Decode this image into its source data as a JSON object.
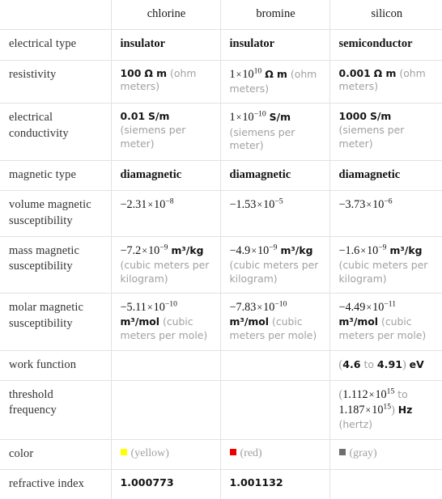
{
  "table": {
    "columns": [
      "",
      "chlorine",
      "bromine",
      "silicon"
    ],
    "rows": [
      {
        "label": "electrical type",
        "cells": [
          {
            "kind": "word",
            "text": "insulator"
          },
          {
            "kind": "word",
            "text": "insulator"
          },
          {
            "kind": "word",
            "text": "semiconductor"
          }
        ]
      },
      {
        "label": "resistivity",
        "cells": [
          {
            "kind": "num_unit",
            "number": "100",
            "unit": "Ω m",
            "note": "(ohm meters)"
          },
          {
            "kind": "sci_unit",
            "mantissa": "1",
            "exponent": "10",
            "unit": "Ω m",
            "note": "(ohm meters)"
          },
          {
            "kind": "num_unit",
            "number": "0.001",
            "unit": "Ω m",
            "note": "(ohm meters)"
          }
        ]
      },
      {
        "label": "electrical conductivity",
        "cells": [
          {
            "kind": "num_unit",
            "number": "0.01",
            "unit": "S/m",
            "note": "(siemens per meter)"
          },
          {
            "kind": "sci_unit",
            "mantissa": "1",
            "exponent": "−10",
            "unit": "S/m",
            "note": "(siemens per meter)"
          },
          {
            "kind": "num_unit",
            "number": "1000",
            "unit": "S/m",
            "note": "(siemens per meter)"
          }
        ]
      },
      {
        "label": "magnetic type",
        "cells": [
          {
            "kind": "word",
            "text": "diamagnetic"
          },
          {
            "kind": "word",
            "text": "diamagnetic"
          },
          {
            "kind": "word",
            "text": "diamagnetic"
          }
        ]
      },
      {
        "label": "volume magnetic susceptibility",
        "cells": [
          {
            "kind": "sci",
            "mantissa": "−2.31",
            "exponent": "−8"
          },
          {
            "kind": "sci",
            "mantissa": "−1.53",
            "exponent": "−5"
          },
          {
            "kind": "sci",
            "mantissa": "−3.73",
            "exponent": "−6"
          }
        ]
      },
      {
        "label": "mass magnetic susceptibility",
        "cells": [
          {
            "kind": "sci_unit",
            "mantissa": "−7.2",
            "exponent": "−9",
            "unit": "m³/kg",
            "note": "(cubic meters per kilogram)"
          },
          {
            "kind": "sci_unit",
            "mantissa": "−4.9",
            "exponent": "−9",
            "unit": "m³/kg",
            "note": "(cubic meters per kilogram)"
          },
          {
            "kind": "sci_unit",
            "mantissa": "−1.6",
            "exponent": "−9",
            "unit": "m³/kg",
            "note": "(cubic meters per kilogram)"
          }
        ]
      },
      {
        "label": "molar magnetic susceptibility",
        "cells": [
          {
            "kind": "sci_unit",
            "mantissa": "−5.11",
            "exponent": "−10",
            "unit": "m³/mol",
            "note": "(cubic meters per mole)"
          },
          {
            "kind": "sci_unit",
            "mantissa": "−7.83",
            "exponent": "−10",
            "unit": "m³/mol",
            "note": "(cubic meters per mole)"
          },
          {
            "kind": "sci_unit",
            "mantissa": "−4.49",
            "exponent": "−11",
            "unit": "m³/mol",
            "note": "(cubic meters per mole)"
          }
        ]
      },
      {
        "label": "work function",
        "cells": [
          {
            "kind": "empty"
          },
          {
            "kind": "empty"
          },
          {
            "kind": "range",
            "low": "4.6",
            "high": "4.91",
            "joiner": "to",
            "unit": "eV"
          }
        ]
      },
      {
        "label": "threshold frequency",
        "cells": [
          {
            "kind": "empty"
          },
          {
            "kind": "empty"
          },
          {
            "kind": "range_sci",
            "low_mantissa": "1.112",
            "low_exponent": "15",
            "high_mantissa": "1.187",
            "high_exponent": "15",
            "joiner": "to",
            "unit": "Hz",
            "note": "(hertz)"
          }
        ]
      },
      {
        "label": "color",
        "cells": [
          {
            "kind": "color",
            "name": "(yellow)",
            "hex": "#ffff00"
          },
          {
            "kind": "color",
            "name": "(red)",
            "hex": "#ee0000"
          },
          {
            "kind": "color",
            "name": "(gray)",
            "hex": "#6e6e6e"
          }
        ]
      },
      {
        "label": "refractive index",
        "cells": [
          {
            "kind": "plain",
            "text": "1.000773"
          },
          {
            "kind": "plain",
            "text": "1.001132"
          },
          {
            "kind": "empty"
          }
        ]
      }
    ]
  },
  "style": {
    "border_color": "#e2e2e2",
    "text_color": "#1a1a1a",
    "muted_color": "#a0a0a0"
  }
}
